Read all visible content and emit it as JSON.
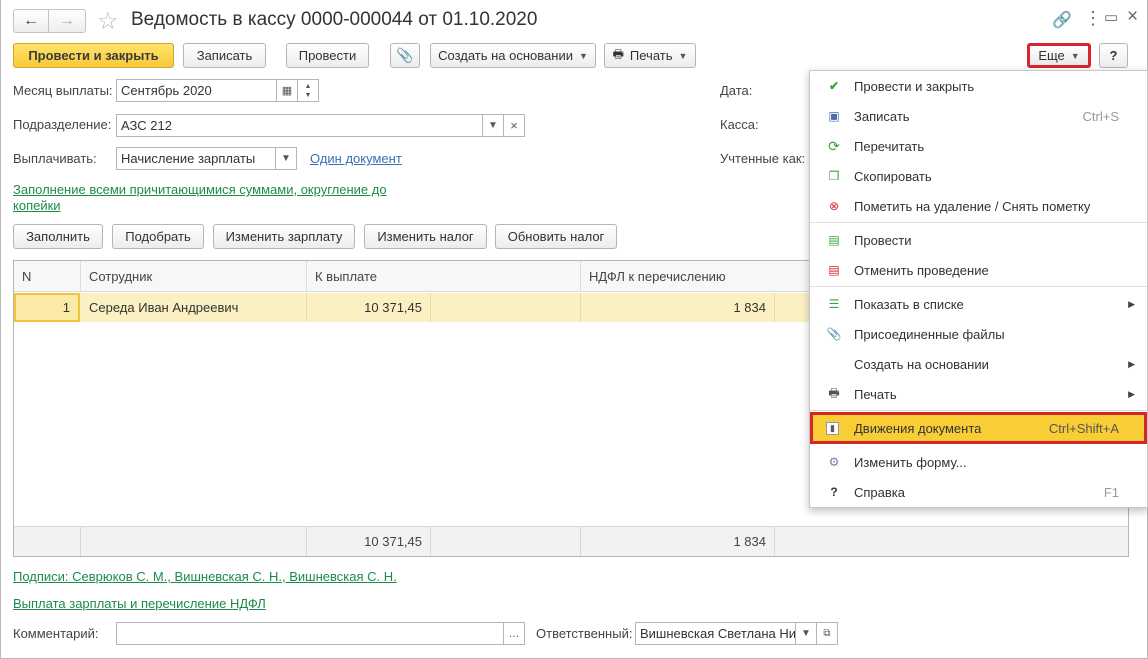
{
  "window": {
    "title": "Ведомость в кассу 0000-000044 от 01.10.2020"
  },
  "toolbar": {
    "post_close": "Провести и закрыть",
    "save": "Записать",
    "post": "Провести",
    "create_based": "Создать на основании",
    "print": "Печать",
    "more": "Еще",
    "help": "?"
  },
  "form": {
    "month_label": "Месяц выплаты:",
    "month_value": "Сентябрь 2020",
    "division_label": "Подразделение:",
    "division_value": "АЗС 212",
    "pay_label": "Выплачивать:",
    "pay_value": "Начисление зарплаты",
    "one_doc_link": "Один документ",
    "date_label": "Дата:",
    "cash_label": "Касса:",
    "counted_label": "Учтенные как:",
    "fill_link": "Заполнение всеми причитающимися суммами, округление до копейки"
  },
  "actions": {
    "fill": "Заполнить",
    "select": "Подобрать",
    "change_salary": "Изменить зарплату",
    "change_tax": "Изменить налог",
    "refresh_tax": "Обновить налог"
  },
  "table": {
    "columns": [
      "N",
      "Сотрудник",
      "К выплате",
      "НДФЛ к перечислению"
    ],
    "rows": [
      {
        "n": "1",
        "employee": "Середа Иван Андреевич",
        "to_pay": "10 371,45",
        "ndfl": "1 834"
      }
    ],
    "totals": {
      "to_pay": "10 371,45",
      "ndfl": "1 834"
    }
  },
  "footer": {
    "signatures_link": "Подписи: Севрюков С. М., Вишневская С. Н., Вишневская С. Н.",
    "payment_link": "Выплата зарплаты и перечисление НДФЛ",
    "comment_label": "Комментарий:",
    "comment_value": "",
    "responsible_label": "Ответственный:",
    "responsible_value": "Вишневская Светлана Ни"
  },
  "menu": {
    "items": [
      {
        "label": "Провести и закрыть",
        "icon": "check-icon"
      },
      {
        "label": "Записать",
        "shortcut": "Ctrl+S",
        "icon": "save-icon"
      },
      {
        "label": "Перечитать",
        "icon": "refresh-icon"
      },
      {
        "label": "Скопировать",
        "icon": "copy-icon"
      },
      {
        "label": "Пометить на удаление / Снять пометку",
        "icon": "delete-mark-icon"
      },
      {
        "label": "Провести",
        "icon": "post-icon"
      },
      {
        "label": "Отменить проведение",
        "icon": "unpost-icon"
      },
      {
        "label": "Показать в списке",
        "icon": "list-icon"
      },
      {
        "label": "Присоединенные файлы",
        "icon": "paperclip-icon"
      },
      {
        "label": "Создать на основании",
        "icon": ""
      },
      {
        "label": "Печать",
        "icon": "print-icon"
      },
      {
        "label": "Движения документа",
        "shortcut": "Ctrl+Shift+A",
        "icon": "movements-icon"
      },
      {
        "label": "Изменить форму...",
        "icon": "form-settings-icon"
      },
      {
        "label": "Справка",
        "shortcut": "F1",
        "icon": "help-icon"
      }
    ]
  },
  "colors": {
    "accent_yellow": "#f9cd35",
    "highlight_red": "#d6262b",
    "link_green": "#1d8b49"
  }
}
